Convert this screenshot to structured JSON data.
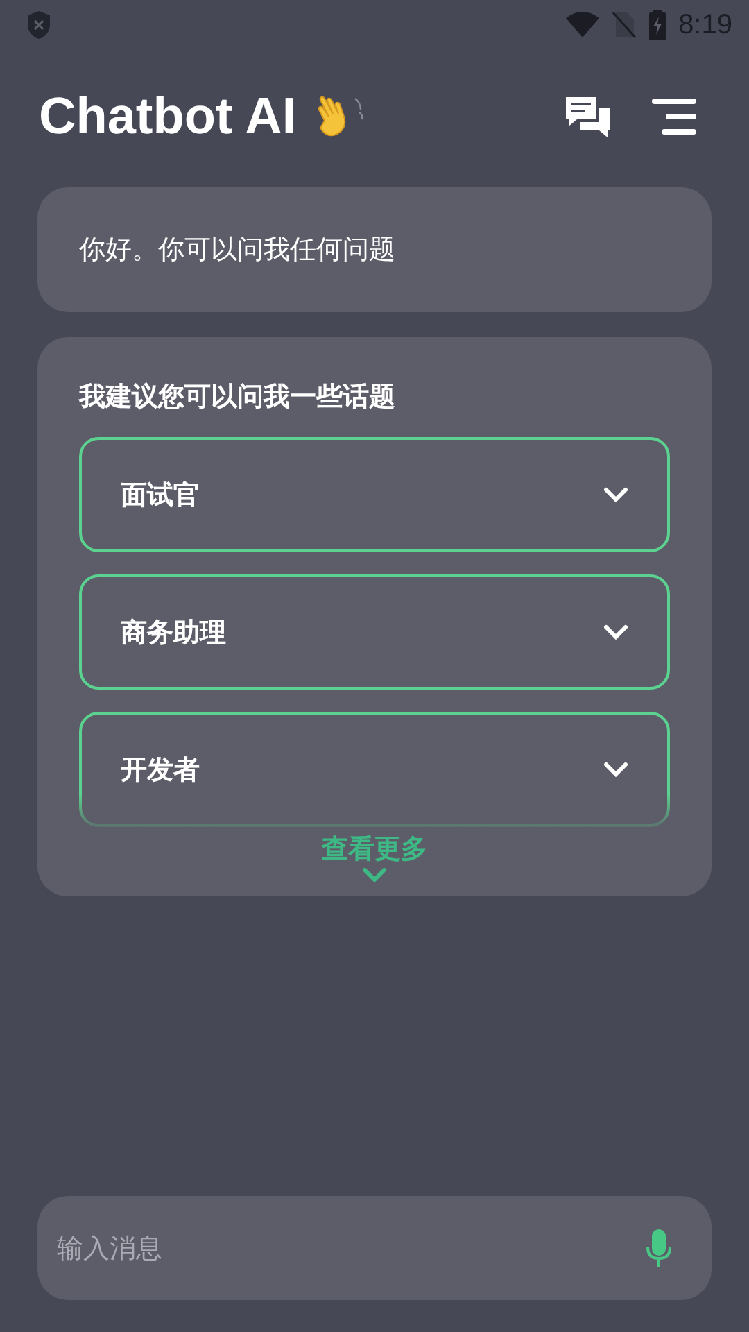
{
  "status_bar": {
    "time": "8:19"
  },
  "header": {
    "title": "Chatbot AI"
  },
  "greeting": {
    "text": "你好。你可以问我任何问题"
  },
  "suggestions": {
    "heading": "我建议您可以问我一些话题",
    "topics": [
      {
        "label": "面试官",
        "expanded": false
      },
      {
        "label": "商务助理",
        "expanded": false
      },
      {
        "label": "开发者",
        "expanded": false
      }
    ],
    "more": "查看更多"
  },
  "input": {
    "placeholder": "输入消息"
  }
}
